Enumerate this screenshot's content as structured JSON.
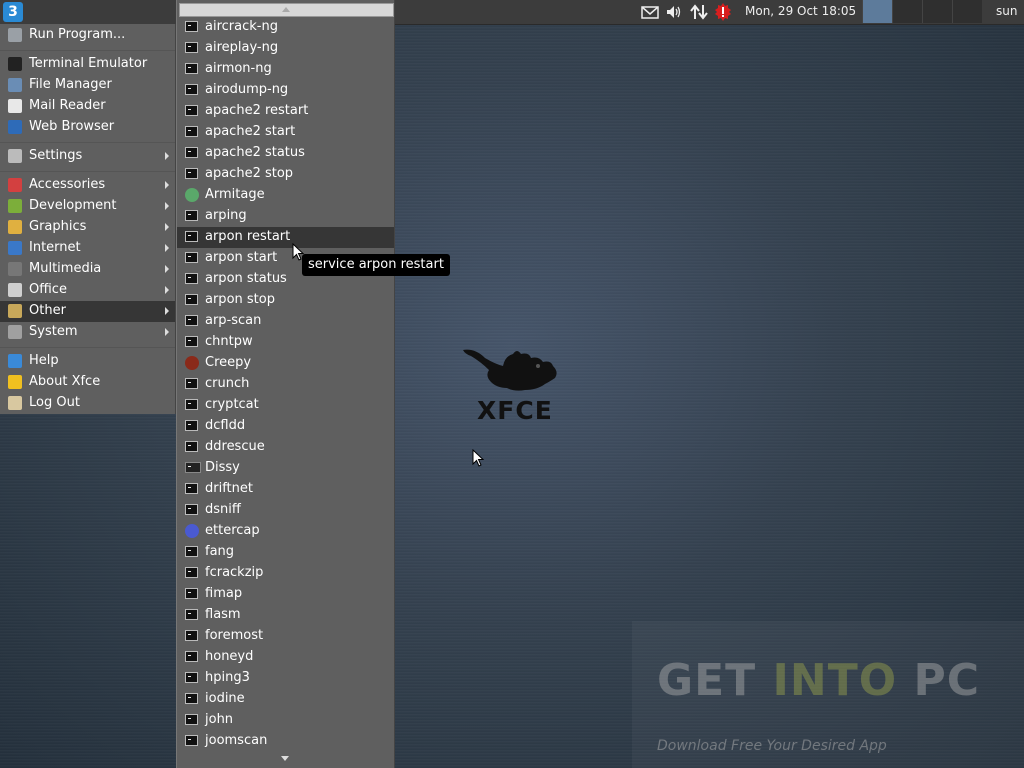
{
  "panel": {
    "clock": "Mon, 29 Oct  18:05",
    "user": "sun",
    "tray_icons": [
      "mail-icon",
      "volume-icon",
      "network-icon",
      "update-notifier-icon"
    ],
    "active_workspace_color": "#5d7b9b"
  },
  "main_menu": {
    "items": [
      {
        "label": "Run Program...",
        "icon": "run-icon"
      },
      {
        "label": "Terminal Emulator",
        "icon": "terminal-icon"
      },
      {
        "label": "File Manager",
        "icon": "file-manager-icon"
      },
      {
        "label": "Mail Reader",
        "icon": "mail-reader-icon"
      },
      {
        "label": "Web Browser",
        "icon": "web-browser-icon"
      },
      {
        "label": "Settings",
        "icon": "settings-icon",
        "submenu": true
      },
      {
        "label": "Accessories",
        "icon": "accessories-icon",
        "submenu": true
      },
      {
        "label": "Development",
        "icon": "development-icon",
        "submenu": true
      },
      {
        "label": "Graphics",
        "icon": "graphics-icon",
        "submenu": true
      },
      {
        "label": "Internet",
        "icon": "internet-icon",
        "submenu": true
      },
      {
        "label": "Multimedia",
        "icon": "multimedia-icon",
        "submenu": true
      },
      {
        "label": "Office",
        "icon": "office-icon",
        "submenu": true
      },
      {
        "label": "Other",
        "icon": "other-icon",
        "submenu": true,
        "active": true
      },
      {
        "label": "System",
        "icon": "system-icon",
        "submenu": true
      },
      {
        "label": "Help",
        "icon": "help-icon"
      },
      {
        "label": "About Xfce",
        "icon": "about-icon"
      },
      {
        "label": "Log Out",
        "icon": "logout-icon"
      }
    ]
  },
  "submenu": {
    "items": [
      {
        "label": "aircrack-ng"
      },
      {
        "label": "aireplay-ng"
      },
      {
        "label": "airmon-ng"
      },
      {
        "label": "airodump-ng"
      },
      {
        "label": "apache2 restart"
      },
      {
        "label": "apache2 start"
      },
      {
        "label": "apache2 status"
      },
      {
        "label": "apache2 stop"
      },
      {
        "label": "Armitage",
        "icon": "armitage-icon"
      },
      {
        "label": "arping"
      },
      {
        "label": "arpon restart",
        "active": true
      },
      {
        "label": "arpon start"
      },
      {
        "label": "arpon status"
      },
      {
        "label": "arpon stop"
      },
      {
        "label": "arp-scan"
      },
      {
        "label": "chntpw"
      },
      {
        "label": "Creepy",
        "icon": "creepy-icon"
      },
      {
        "label": "crunch"
      },
      {
        "label": "cryptcat"
      },
      {
        "label": "dcfldd"
      },
      {
        "label": "ddrescue"
      },
      {
        "label": "Dissy",
        "icon": "dissy-icon"
      },
      {
        "label": "driftnet"
      },
      {
        "label": "dsniff"
      },
      {
        "label": "ettercap",
        "icon": "ettercap-icon"
      },
      {
        "label": "fang"
      },
      {
        "label": "fcrackzip"
      },
      {
        "label": "fimap"
      },
      {
        "label": "flasm"
      },
      {
        "label": "foremost"
      },
      {
        "label": "honeyd"
      },
      {
        "label": "hping3"
      },
      {
        "label": "iodine"
      },
      {
        "label": "john"
      },
      {
        "label": "joomscan"
      }
    ]
  },
  "tooltip": "service arpon restart",
  "desktop": {
    "logo_text": "XFCE",
    "watermark_get": "GET",
    "watermark_into": "INTO",
    "watermark_pc": "PC",
    "watermark_sub": "Download Free Your Desired App"
  }
}
